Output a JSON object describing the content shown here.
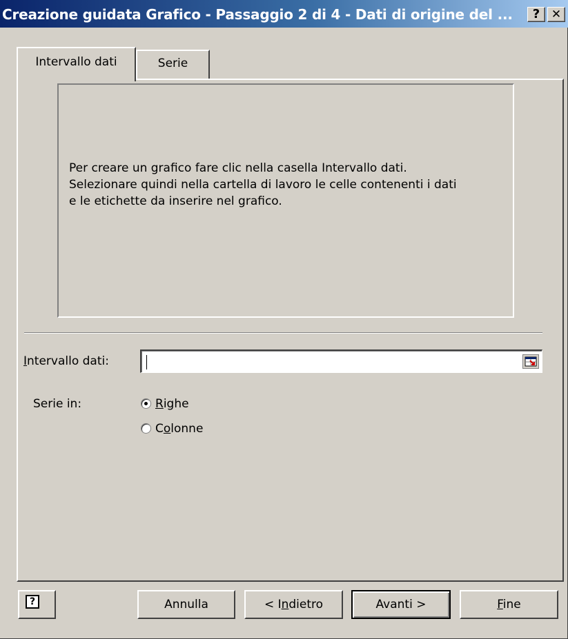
{
  "window": {
    "title": "Creazione guidata Grafico - Passaggio 2 di 4 - Dati di origine del ...",
    "help_glyph": "?",
    "close_glyph": "✕"
  },
  "tabs": [
    {
      "label": "Intervallo dati",
      "active": true
    },
    {
      "label": "Serie",
      "active": false
    }
  ],
  "preview": {
    "line1": "Per creare un grafico fare clic nella casella Intervallo dati.",
    "line2": "Selezionare quindi nella cartella di lavoro le celle contenenti i dati",
    "line3": "e le etichette da inserire nel grafico."
  },
  "range": {
    "label_underlined": "I",
    "label_rest": "ntervallo dati:",
    "value": ""
  },
  "series_in": {
    "label": "Serie in:",
    "options": [
      {
        "pre": "",
        "accel": "R",
        "post": "ighe",
        "selected": true
      },
      {
        "pre": "C",
        "accel": "o",
        "post": "lonne",
        "selected": false
      }
    ]
  },
  "buttons": {
    "help_glyph": "?",
    "cancel": "Annulla",
    "back_pre": "< I",
    "back_accel": "n",
    "back_post": "dietro",
    "next": "Avanti >",
    "finish_accel": "F",
    "finish_post": "ine"
  },
  "colors": {
    "title_start": "#0a246a",
    "title_end": "#a6caf0",
    "face": "#d4d0c8"
  },
  "icons": [
    "help-icon",
    "close-icon",
    "collapse-dialog-icon",
    "wizard-help-icon"
  ]
}
